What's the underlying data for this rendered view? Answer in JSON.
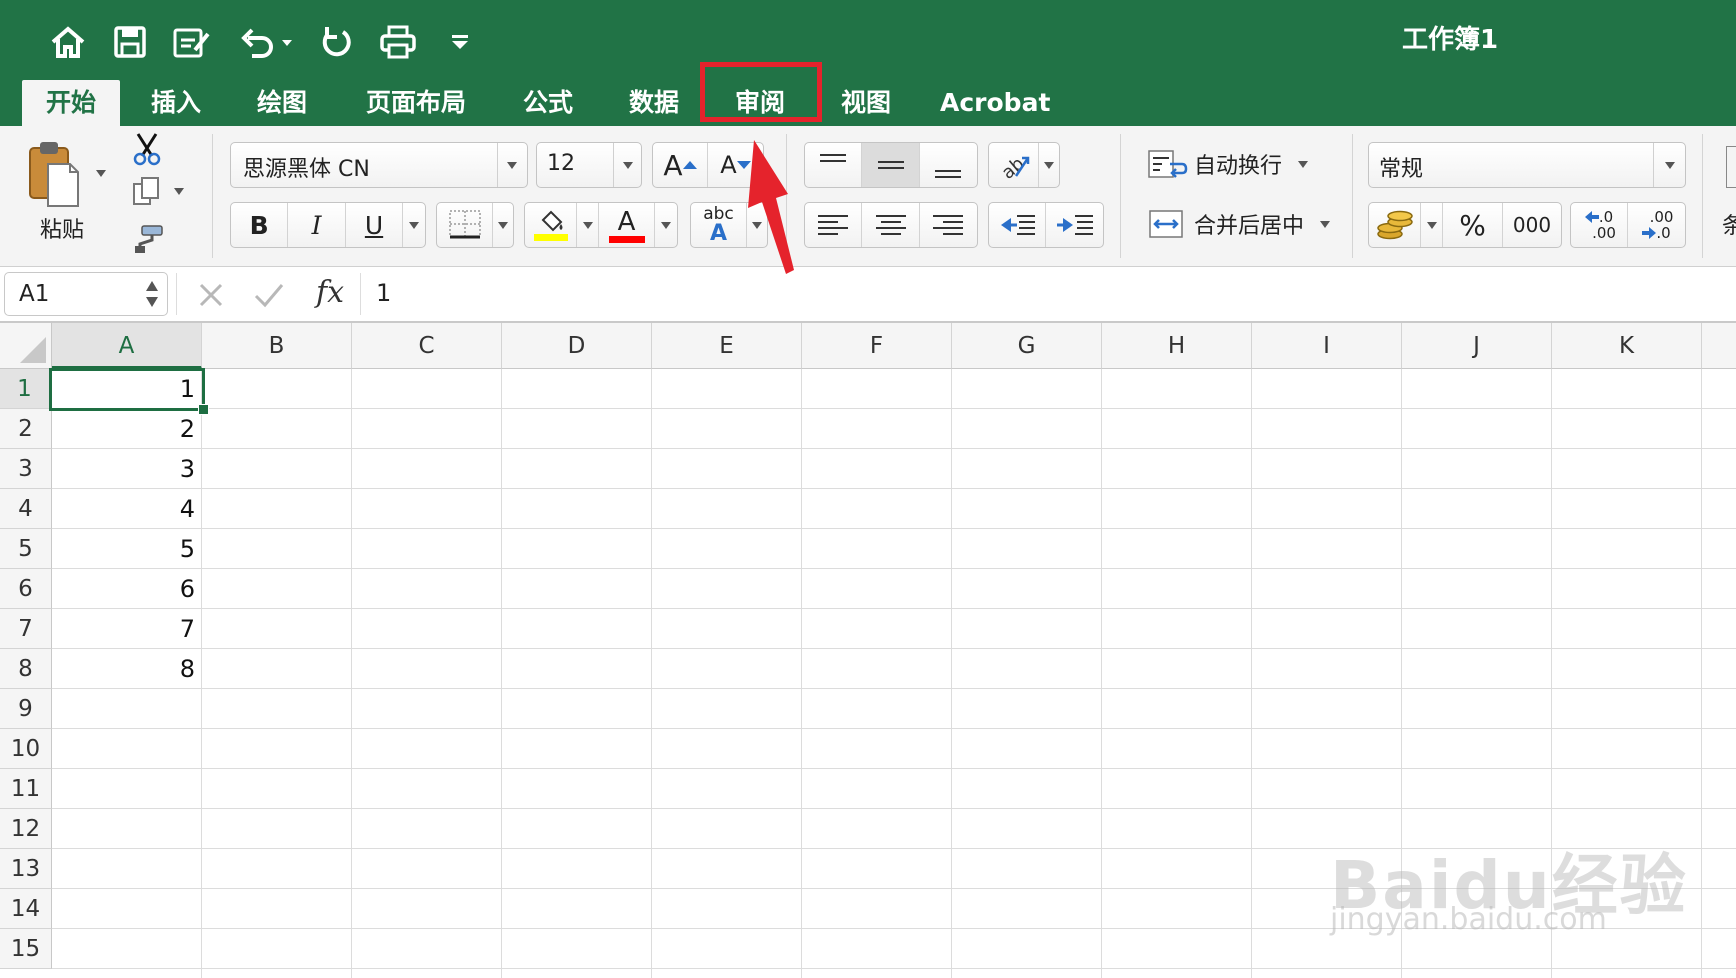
{
  "window": {
    "title": "工作簿1"
  },
  "quick_access": [
    "home-icon",
    "save-icon",
    "edit-icon",
    "undo-icon",
    "redo-icon",
    "print-icon",
    "customize-icon"
  ],
  "tabs": [
    {
      "label": "开始",
      "active": true
    },
    {
      "label": "插入"
    },
    {
      "label": "绘图"
    },
    {
      "label": "页面布局"
    },
    {
      "label": "公式"
    },
    {
      "label": "数据"
    },
    {
      "label": "审阅",
      "highlighted": true
    },
    {
      "label": "视图"
    },
    {
      "label": "Acrobat"
    }
  ],
  "ribbon": {
    "paste_label": "粘贴",
    "font_name": "思源黑体 CN",
    "font_size": "12",
    "bold": "B",
    "italic": "I",
    "underline": "U",
    "font_color_letter": "A",
    "grow_letter": "A",
    "shrink_letter": "A",
    "abc_label": "abc",
    "wrap_text": "自动换行",
    "merge_center": "合并后居中",
    "number_format": "常规",
    "percent": "%",
    "comma": "000",
    "inc_decimal_top": ".0",
    "inc_decimal_bottom": ".00",
    "dec_decimal_top": ".00",
    "dec_decimal_bottom": ".0",
    "cut_off_label": "条",
    "colors": {
      "highlight": "#ffff00",
      "font_color": "#ff0000"
    }
  },
  "formula_bar": {
    "name_box": "A1",
    "fx": "fx",
    "value": "1"
  },
  "sheet": {
    "columns": [
      "A",
      "B",
      "C",
      "D",
      "E",
      "F",
      "G",
      "H",
      "I",
      "J",
      "K"
    ],
    "rows": [
      "1",
      "2",
      "3",
      "4",
      "5",
      "6",
      "7",
      "8",
      "9",
      "10",
      "11",
      "12",
      "13",
      "14",
      "15"
    ],
    "column_a_values": [
      "1",
      "2",
      "3",
      "4",
      "5",
      "6",
      "7",
      "8"
    ],
    "selected_cell": "A1"
  },
  "watermark": {
    "logo": "Baidu经验",
    "url": "jingyan.baidu.com"
  },
  "accent_color": "#217346",
  "annotation_color": "#e5232c"
}
